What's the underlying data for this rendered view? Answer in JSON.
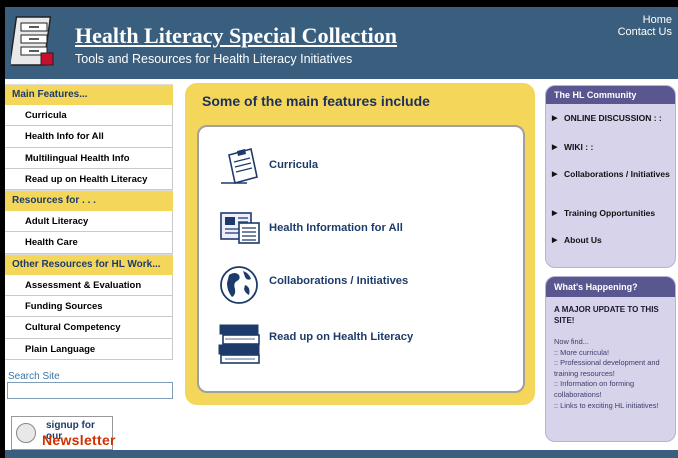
{
  "header": {
    "title": "Health Literacy Special Collection",
    "subtitle": "Tools and Resources for Health Literacy Initiatives",
    "home_link": "Home",
    "contact_link": "Contact Us"
  },
  "leftnav": {
    "sections": [
      {
        "title": "Main Features...",
        "items": [
          "Curricula",
          "Health Info for All",
          "Multilingual Health Info",
          "Read up on Health Literacy"
        ]
      },
      {
        "title": "Resources for . . .",
        "items": [
          "Adult Literacy",
          "Health Care"
        ]
      },
      {
        "title": "Other Resources for HL Work...",
        "items": [
          "Assessment & Evaluation",
          "Funding Sources",
          "Cultural Competency",
          "Plain Language"
        ]
      }
    ],
    "search_label": "Search Site",
    "newsletter": {
      "top": "signup for our",
      "main": "Newsletter"
    }
  },
  "main": {
    "heading": "Some of the main features include",
    "features": [
      {
        "label": "Curricula",
        "icon": "clipboard-icon"
      },
      {
        "label": "Health Information for All",
        "icon": "document-icon"
      },
      {
        "label": "Collaborations / Initiatives",
        "icon": "globe-icon"
      },
      {
        "label": "Read up on Health Literacy",
        "icon": "books-icon"
      }
    ]
  },
  "community": {
    "title": "The HL Community",
    "items": [
      "ONLINE DISCUSSION : :",
      "WIKI : :",
      "Collaborations / Initiatives",
      "Training Opportunities",
      "About Us"
    ]
  },
  "whats_happening": {
    "title": "What's Happening?",
    "major": "A MAJOR UPDATE TO THIS SITE!",
    "lines": [
      "Now find...",
      ":: More curricula!",
      ":: Professional development and training resources!",
      ":: Information on forming collaborations!",
      ":: Links to exciting HL initiatives!"
    ]
  },
  "colors": {
    "header_blue": "#3a5f7e",
    "accent_yellow": "#f4d65a",
    "panel_lavender": "#d6d3ea",
    "panel_header_purple": "#5a568f"
  }
}
